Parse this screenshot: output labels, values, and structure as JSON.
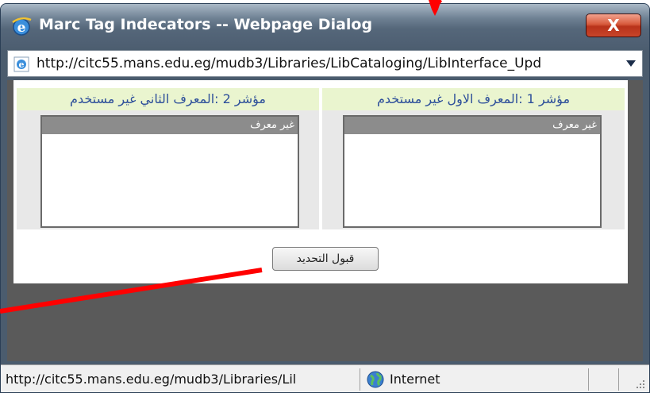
{
  "window": {
    "title": "Marc Tag Indecators -- Webpage Dialog",
    "close_label": "X"
  },
  "address": {
    "url": "http://citc55.mans.edu.eg/mudb3/Libraries/LibCataloging/LibInterface_Upd"
  },
  "indicators": {
    "indicator1_header": "مؤشر 1 :المعرف الاول غير مستخدم",
    "indicator2_header": "مؤشر 2 :المعرف الثاني غير مستخدم",
    "indicator1_selected": "غير معرف",
    "indicator2_selected": "غير معرف",
    "accept_label": "قبول التحديد"
  },
  "status": {
    "url": "http://citc55.mans.edu.eg/mudb3/Libraries/Lil",
    "zone": "Internet"
  },
  "colors": {
    "header_bg": "#eaf5cf",
    "header_text": "#2d4f9a",
    "annotation": "#ff0000"
  },
  "icons": [
    "ie-icon",
    "page-ie-icon",
    "internet-globe-icon",
    "resize-grip-icon"
  ]
}
